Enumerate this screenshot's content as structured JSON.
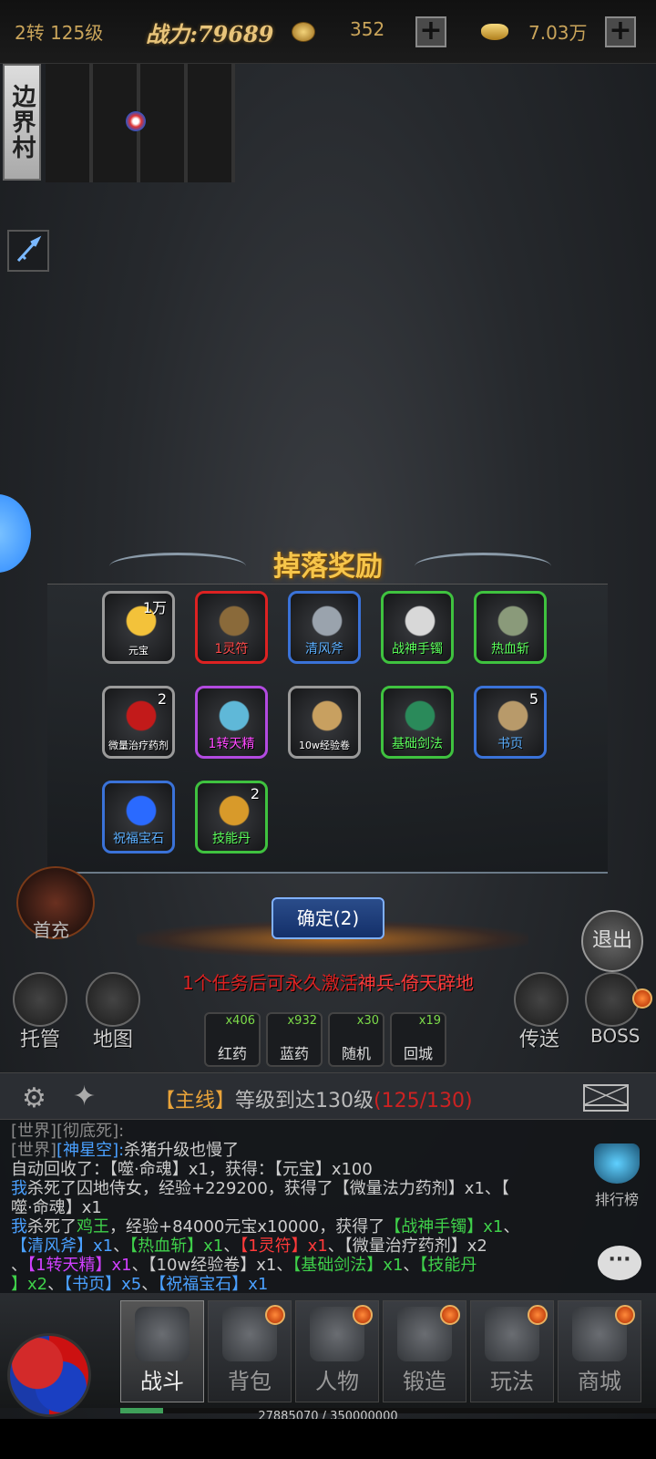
{
  "topbar": {
    "level": "2转 125级",
    "power": "战力:79689",
    "coin_icon": "coin-icon",
    "coins": "352",
    "ingot_icon": "ingot-icon",
    "ingots": "7.03万",
    "plus": "+"
  },
  "map": {
    "name": "边界村"
  },
  "drops": {
    "title": "掉落奖励",
    "items": [
      {
        "name": "元宝",
        "count": "1万",
        "quality": "gray"
      },
      {
        "name": "1灵符",
        "count": "",
        "quality": "red"
      },
      {
        "name": "清风斧",
        "count": "",
        "quality": "blue"
      },
      {
        "name": "战神手镯",
        "count": "",
        "quality": "green"
      },
      {
        "name": "热血斩",
        "count": "",
        "quality": "green"
      },
      {
        "name": "微量治疗药剂",
        "count": "2",
        "quality": "gray"
      },
      {
        "name": "1转天精",
        "count": "",
        "quality": "purple"
      },
      {
        "name": "10w经验卷",
        "count": "",
        "quality": "gray"
      },
      {
        "name": "基础剑法",
        "count": "",
        "quality": "green"
      },
      {
        "name": "书页",
        "count": "5",
        "quality": "blue"
      },
      {
        "name": "祝福宝石",
        "count": "",
        "quality": "blue"
      },
      {
        "name": "技能丹",
        "count": "2",
        "quality": "green"
      }
    ],
    "confirm": "确定(2)"
  },
  "notice": {
    "pre": "1个任务后可永久激活",
    "highlight": "神兵-倚天辟地"
  },
  "side": {
    "recharge": "首充",
    "exit": "退出",
    "auto": "托管",
    "map": "地图",
    "teleport": "传送",
    "boss": "BOSS"
  },
  "potions": [
    {
      "name": "红药",
      "count": "x406"
    },
    {
      "name": "蓝药",
      "count": "x932"
    },
    {
      "name": "随机",
      "count": "x30"
    },
    {
      "name": "回城",
      "count": "x19"
    }
  ],
  "quest": {
    "tag": "【主线】",
    "text": "等级到达130级",
    "progress": "(125/130)"
  },
  "chat": {
    "line0": "[世界][彻底死]:",
    "world_prefix": "[世界]",
    "world_name": "[神星空]:",
    "world_msg": "杀猪升级也慢了",
    "l2": "自动回收了：【噬·命魂】x1，获得：【元宝】x100",
    "l3a": "我",
    "l3b": "杀死了囚地侍女，经验+229200，获得了【微量法力药剂】x1、【",
    "l4": "噬·命魂】x1",
    "l5a": "我",
    "l5b": "杀死了",
    "l5c": "鸡王",
    "l5d": "，经验+84000元宝x10000，获得了",
    "l5e": "【战神手镯】x1",
    "l5f": "、",
    "l6a": "【清风斧】x1",
    "l6b": "、",
    "l6c": "【热血斩】x1",
    "l6d": "、",
    "l6e": "【1灵符】x1",
    "l6f": "、【微量治疗药剂】x2",
    "l7a": "、",
    "l7b": "【1转天精】x1",
    "l7c": "、【10w经验卷】x1、",
    "l7d": "【基础剑法】x1",
    "l7e": "、",
    "l7f": "【技能丹",
    "l8a": "】x2",
    "l8b": "、",
    "l8c": "【书页】x5",
    "l8d": "、",
    "l8e": "【祝福宝石】x1",
    "rank": "排行榜",
    "bubble": "···"
  },
  "nav": {
    "tabs": [
      "战斗",
      "背包",
      "人物",
      "锻造",
      "玩法",
      "商城"
    ],
    "exp_text": "27885070 / 350000000",
    "exp_fraction": 0.0797
  },
  "colors": {
    "gold": "#f6c54a",
    "red": "#ff3a3a",
    "green": "#3fd04a",
    "blue": "#4aa0ff",
    "purple": "#d040ff"
  }
}
